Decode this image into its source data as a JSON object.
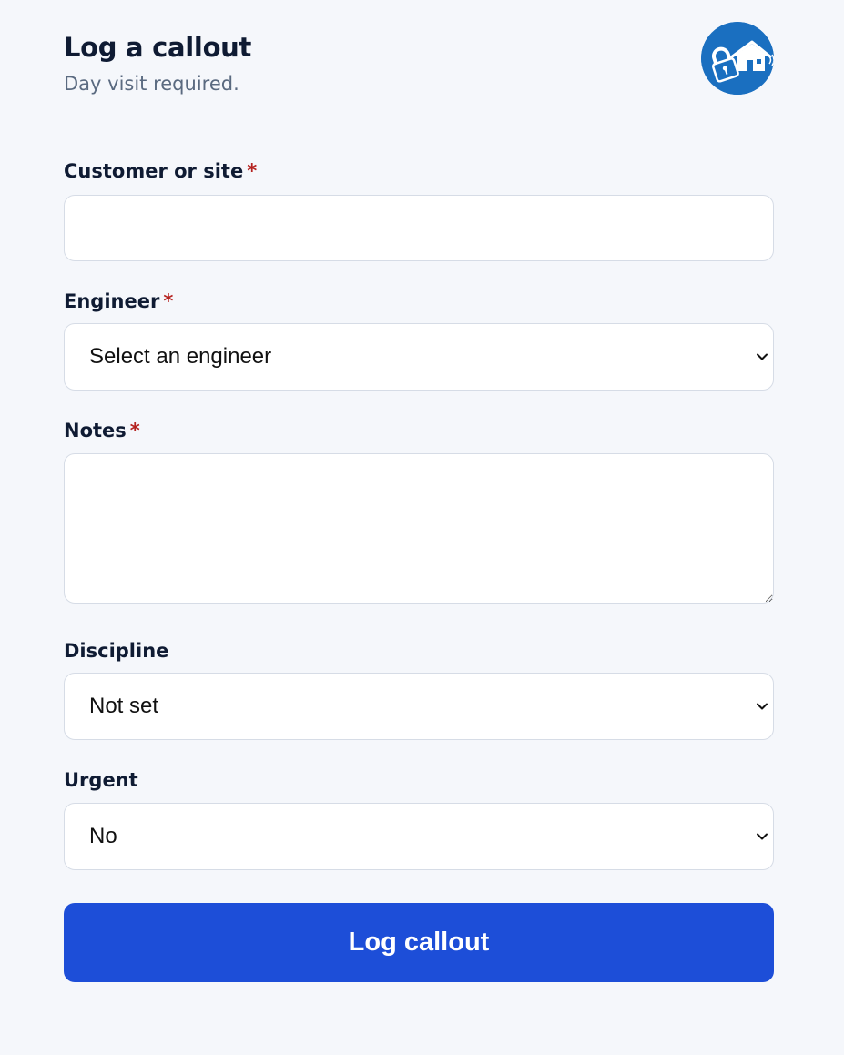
{
  "header": {
    "title": "Log a callout",
    "subtitle": "Day visit required."
  },
  "logo": {
    "icon": "house-lock-icon",
    "color": "#1a6fc0"
  },
  "required_marker": "*",
  "form": {
    "customer": {
      "label": "Customer or site",
      "value": "",
      "placeholder": ""
    },
    "engineer": {
      "label": "Engineer",
      "selected": "Select an engineer"
    },
    "notes": {
      "label": "Notes",
      "value": ""
    },
    "discipline": {
      "label": "Discipline",
      "selected": "Not set"
    },
    "urgent": {
      "label": "Urgent",
      "selected": "No"
    }
  },
  "submit": {
    "label": "Log callout",
    "color": "#1d4ed8"
  }
}
